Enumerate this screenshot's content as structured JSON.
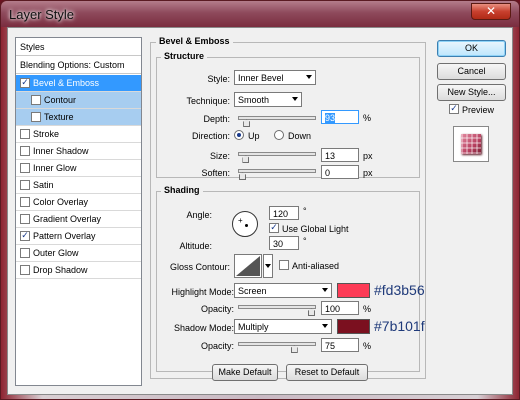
{
  "window": {
    "title": "Layer Style",
    "close_glyph": "✕"
  },
  "styles_panel": {
    "header": "Styles",
    "blending_options": "Blending Options: Custom",
    "items": [
      {
        "label": "Bevel & Emboss",
        "checked": true,
        "selected": true
      },
      {
        "label": "Contour",
        "checked": false,
        "sub": true
      },
      {
        "label": "Texture",
        "checked": false,
        "sub": true
      },
      {
        "label": "Stroke",
        "checked": false
      },
      {
        "label": "Inner Shadow",
        "checked": false
      },
      {
        "label": "Inner Glow",
        "checked": false
      },
      {
        "label": "Satin",
        "checked": false
      },
      {
        "label": "Color Overlay",
        "checked": false
      },
      {
        "label": "Gradient Overlay",
        "checked": false
      },
      {
        "label": "Pattern Overlay",
        "checked": true
      },
      {
        "label": "Outer Glow",
        "checked": false
      },
      {
        "label": "Drop Shadow",
        "checked": false
      }
    ]
  },
  "bevel": {
    "group_title": "Bevel & Emboss",
    "structure_title": "Structure",
    "style_label": "Style:",
    "style_value": "Inner Bevel",
    "technique_label": "Technique:",
    "technique_value": "Smooth",
    "depth_label": "Depth:",
    "depth_value": "93",
    "depth_unit": "%",
    "depth_level": 0.06,
    "direction_label": "Direction:",
    "direction_up": "Up",
    "direction_down": "Down",
    "size_label": "Size:",
    "size_value": "13",
    "size_unit": "px",
    "size_level": 0.05,
    "soften_label": "Soften:",
    "soften_value": "0",
    "soften_unit": "px",
    "soften_level": 0.0
  },
  "shading": {
    "title": "Shading",
    "angle_label": "Angle:",
    "angle_value": "120",
    "degree_sign": "°",
    "use_global_light": "Use Global Light",
    "altitude_label": "Altitude:",
    "altitude_value": "30",
    "gloss_contour_label": "Gloss Contour:",
    "anti_aliased": "Anti-aliased",
    "highlight_mode_label": "Highlight Mode:",
    "highlight_mode_value": "Screen",
    "highlight_color": "#fd3b56",
    "highlight_hex_label": "#fd3b56",
    "highlight_opacity_label": "Opacity:",
    "highlight_opacity_value": "100",
    "highlight_opacity_level": 1.0,
    "shadow_mode_label": "Shadow Mode:",
    "shadow_mode_value": "Multiply",
    "shadow_color": "#7b101f",
    "shadow_hex_label": "#7b101f",
    "shadow_opacity_label": "Opacity:",
    "shadow_opacity_value": "75",
    "shadow_opacity_level": 0.75,
    "percent": "%"
  },
  "buttons": {
    "make_default": "Make Default",
    "reset_to_default": "Reset to Default",
    "ok": "OK",
    "cancel": "Cancel",
    "new_style": "New Style...",
    "preview": "Preview"
  }
}
